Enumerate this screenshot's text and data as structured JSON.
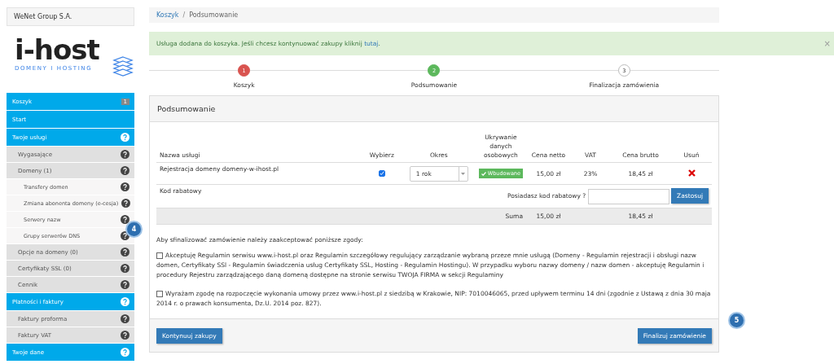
{
  "sidebar": {
    "company": "WeNet Group S.A.",
    "logo": {
      "name": "i-host",
      "tagline": "DOMENY I HOSTING"
    },
    "items": [
      {
        "kind": "section",
        "label": "Koszyk",
        "badge": "1",
        "help": false
      },
      {
        "kind": "section",
        "label": "Start",
        "help": false
      },
      {
        "kind": "section",
        "label": "Twoje usługi",
        "help": true,
        "children": [
          {
            "kind": "item",
            "label": "Wygasające",
            "help": true
          },
          {
            "kind": "item",
            "label": "Domeny (1)",
            "help": true,
            "children": [
              {
                "kind": "subitem",
                "label": "Transfery domen",
                "help": true
              },
              {
                "kind": "subitem",
                "label": "Zmiana abonenta domeny (e-cesja)",
                "help": true
              },
              {
                "kind": "subitem",
                "label": "Serwery nazw",
                "help": true
              },
              {
                "kind": "subitem",
                "label": "Grupy serwerów DNS",
                "help": true
              }
            ]
          },
          {
            "kind": "item",
            "label": "Opcje na domeny (0)",
            "help": true
          },
          {
            "kind": "item",
            "label": "Certyfikaty SSL (0)",
            "help": true
          },
          {
            "kind": "item",
            "label": "Cennik",
            "help": true
          }
        ]
      },
      {
        "kind": "section",
        "label": "Płatności i faktury",
        "help": true,
        "children": [
          {
            "kind": "item",
            "label": "Faktury proforma",
            "help": true
          },
          {
            "kind": "item",
            "label": "Faktury VAT",
            "help": true
          }
        ]
      },
      {
        "kind": "section",
        "label": "Twoje dane",
        "help": true
      }
    ]
  },
  "breadcrumb_separator": "/",
  "breadcrumb": [
    {
      "label": "Koszyk",
      "link": true
    },
    {
      "label": "Podsumowanie",
      "link": false
    }
  ],
  "alert": {
    "text": "Usługa dodana do koszyka. Jeśli chcesz kontynuować zakupy kliknij",
    "link": "tutaj",
    "end": ".",
    "close": "×"
  },
  "steps": [
    {
      "number": "1",
      "label": "Koszyk",
      "color": "#d9534f"
    },
    {
      "number": "2",
      "label": "Podsumowanie",
      "color": "#5cb85c"
    },
    {
      "number": "3",
      "label": "Finalizacja zamówienia",
      "color": "#ffffff"
    }
  ],
  "panel": {
    "title": "Podsumowanie",
    "table": {
      "columns": [
        "Nazwa usługi",
        "Wybierz",
        "Okres",
        "Ukrywanie danych osobowych",
        "Cena netto",
        "VAT",
        "Cena brutto",
        "Usuń"
      ],
      "rows": [
        {
          "name": "Rejestracja domeny domeny-w-ihost.pl",
          "checked": true,
          "period": "1 rok",
          "privacy": "Wbudowane",
          "net": "15,00 zł",
          "vat": "23%",
          "gross": "18,45 zł"
        }
      ],
      "discount": {
        "label": "Kod rabatowy",
        "question": "Posiadasz kod rabatowy ?",
        "button": "Zastosuj"
      },
      "sum": {
        "label": "Suma",
        "net": "15,00 zł",
        "gross": "18,45 zł"
      }
    },
    "consent_intro": "Aby sfinalizować zamówienie należy zaakceptować poniższe zgody:",
    "consents": [
      {
        "checked": false,
        "text": "Akceptuję Regulamin serwisu www.i-host.pl oraz Regulamin szczegółowy regulujący zarządzanie wybraną przeze mnie usługą (Domeny - Regulamin rejestracji i obsługi nazw domen, Certyfikaty SSl - Regulamin świadczenia usług Certyfikaty SSL, Hosting - Regulamin Hostingu). W przypadku wyboru nazwy domeny / nazw domen - akceptuję Regulamin i procedury Rejestru zarządzającego daną domeną dostępne na stronie serwisu TWOJA FIRMA w sekcji Regulaminy"
      },
      {
        "checked": false,
        "text": "Wyrażam zgodę na rozpoczęcie wykonania umowy przez www.i-host.pl z siedzibą w Krakowie, NIP: 7010046065, przed upływem terminu 14 dni (zgodnie z Ustawą z dnia 30 maja 2014 r. o prawach konsumenta, Dz.U. 2014 poz. 827)."
      }
    ],
    "buttons": [
      "Kontynuuj zakupy",
      "Finalizuj zamówienie"
    ]
  },
  "callouts": [
    {
      "number": "4"
    },
    {
      "number": "5"
    }
  ]
}
